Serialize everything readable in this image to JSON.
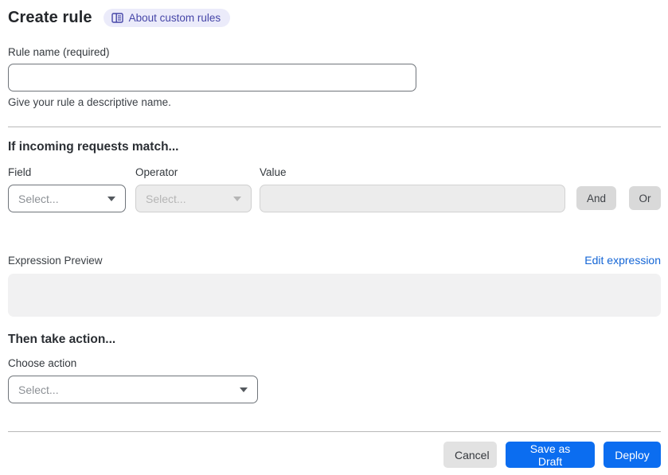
{
  "header": {
    "title": "Create rule",
    "about_link": {
      "label": "About custom rules",
      "icon": "book-icon"
    }
  },
  "rule_name": {
    "label": "Rule name (required)",
    "value": "",
    "placeholder": "",
    "helper": "Give your rule a descriptive name."
  },
  "match_section": {
    "heading": "If incoming requests match...",
    "field": {
      "label": "Field",
      "value": "Select...",
      "enabled": true
    },
    "operator": {
      "label": "Operator",
      "value": "Select...",
      "enabled": false
    },
    "value": {
      "label": "Value",
      "value": "",
      "enabled": false
    },
    "and_button": "And",
    "or_button": "Or"
  },
  "expression": {
    "preview_label": "Expression Preview",
    "edit_link": "Edit expression",
    "content": ""
  },
  "action_section": {
    "heading": "Then take action...",
    "choose_label": "Choose action",
    "select_value": "Select..."
  },
  "footer": {
    "cancel": "Cancel",
    "save_draft": "Save as Draft",
    "deploy": "Deploy"
  },
  "colors": {
    "primary_blue": "#0b6df0",
    "link_blue": "#1365d6",
    "badge_bg": "#ebebfa",
    "badge_text": "#4646a8",
    "disabled_bg": "#ececec",
    "panel_gray": "#f1f1f2"
  }
}
